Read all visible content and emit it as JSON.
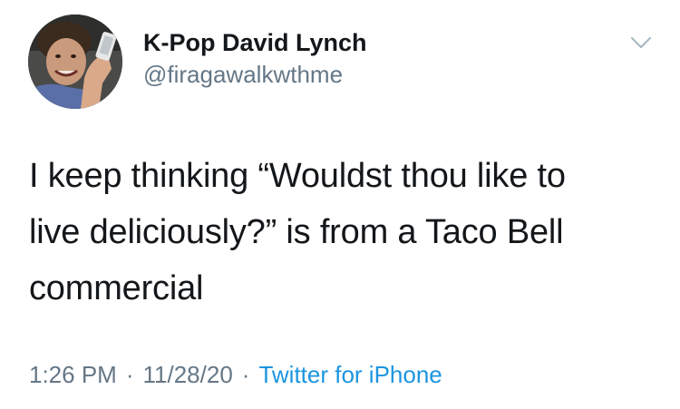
{
  "tweet": {
    "display_name": "K-Pop David Lynch",
    "handle": "@firagawalkwthme",
    "text_lines": [
      "I keep thinking “Wouldst thou like to",
      "live deliciously?” is from a Taco Bell",
      "commercial"
    ],
    "time": "1:26 PM",
    "separator": "·",
    "date": "11/28/20",
    "source": "Twitter for iPhone"
  },
  "icons": {
    "menu": "chevron-down-icon",
    "avatar": "profile-avatar"
  },
  "colors": {
    "text": "#14171a",
    "secondary": "#657786",
    "link": "#1b95e0",
    "chevron": "#aab8c2"
  }
}
